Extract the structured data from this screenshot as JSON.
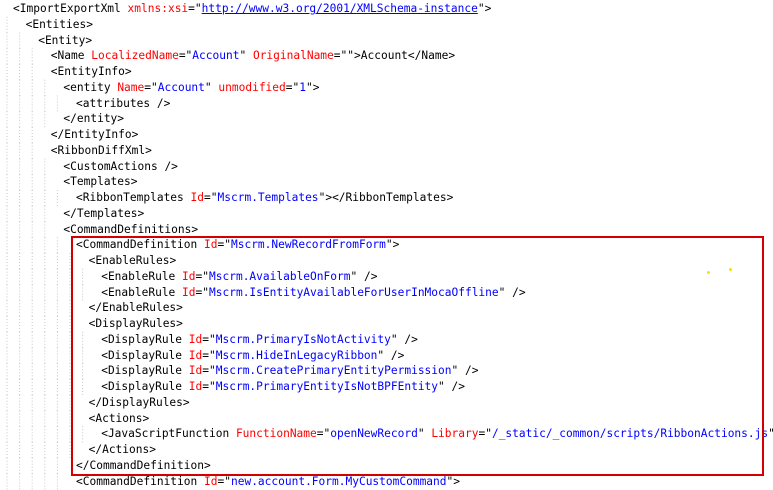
{
  "highlight_color": "#d40000",
  "lines": [
    {
      "lt": "<",
      "tag": "ImportExportXml",
      "parts": [
        {
          "a": "xmlns:xsi",
          "v": "http://www.w3.org/2001/XMLSchema-instance",
          "url": true
        }
      ],
      "end": ">"
    },
    {
      "lt": "<",
      "tag": "Entities",
      "parts": [],
      "end": ">"
    },
    {
      "lt": "<",
      "tag": "Entity",
      "parts": [],
      "end": ">"
    },
    {
      "lt": "<",
      "tag": "Name",
      "parts": [
        {
          "a": "LocalizedName",
          "v": "Account"
        },
        {
          "a": "OriginalName",
          "v": ""
        }
      ],
      "end": ">",
      "text": "Account",
      "close": "</Name>"
    },
    {
      "lt": "<",
      "tag": "EntityInfo",
      "parts": [],
      "end": ">"
    },
    {
      "lt": "<",
      "tag": "entity",
      "parts": [
        {
          "a": "Name",
          "v": "Account"
        },
        {
          "a": "unmodified",
          "v": "1"
        }
      ],
      "end": ">"
    },
    {
      "lt": "<",
      "tag": "attributes",
      "parts": [],
      "end": " />"
    },
    {
      "lt": "</",
      "tag": "entity",
      "parts": [],
      "end": ">"
    },
    {
      "lt": "</",
      "tag": "EntityInfo",
      "parts": [],
      "end": ">"
    },
    {
      "lt": "<",
      "tag": "RibbonDiffXml",
      "parts": [],
      "end": ">"
    },
    {
      "lt": "<",
      "tag": "CustomActions",
      "parts": [],
      "end": " />"
    },
    {
      "lt": "<",
      "tag": "Templates",
      "parts": [],
      "end": ">"
    },
    {
      "lt": "<",
      "tag": "RibbonTemplates",
      "parts": [
        {
          "a": "Id",
          "v": "Mscrm.Templates"
        }
      ],
      "end": ">",
      "close": "</RibbonTemplates>"
    },
    {
      "lt": "</",
      "tag": "Templates",
      "parts": [],
      "end": ">"
    },
    {
      "lt": "<",
      "tag": "CommandDefinitions",
      "parts": [],
      "end": ">"
    },
    {
      "lt": "<",
      "tag": "CommandDefinition",
      "parts": [
        {
          "a": "Id",
          "v": "Mscrm.NewRecordFromForm"
        }
      ],
      "end": ">"
    },
    {
      "lt": "<",
      "tag": "EnableRules",
      "parts": [],
      "end": ">"
    },
    {
      "lt": "<",
      "tag": "EnableRule",
      "parts": [
        {
          "a": "Id",
          "v": "Mscrm.AvailableOnForm"
        }
      ],
      "end": " />"
    },
    {
      "lt": "<",
      "tag": "EnableRule",
      "parts": [
        {
          "a": "Id",
          "v": "Mscrm.IsEntityAvailableForUserInMocaOffline"
        }
      ],
      "end": " />"
    },
    {
      "lt": "</",
      "tag": "EnableRules",
      "parts": [],
      "end": ">"
    },
    {
      "lt": "<",
      "tag": "DisplayRules",
      "parts": [],
      "end": ">"
    },
    {
      "lt": "<",
      "tag": "DisplayRule",
      "parts": [
        {
          "a": "Id",
          "v": "Mscrm.PrimaryIsNotActivity"
        }
      ],
      "end": " />"
    },
    {
      "lt": "<",
      "tag": "DisplayRule",
      "parts": [
        {
          "a": "Id",
          "v": "Mscrm.HideInLegacyRibbon"
        }
      ],
      "end": " />"
    },
    {
      "lt": "<",
      "tag": "DisplayRule",
      "parts": [
        {
          "a": "Id",
          "v": "Mscrm.CreatePrimaryEntityPermission"
        }
      ],
      "end": " />"
    },
    {
      "lt": "<",
      "tag": "DisplayRule",
      "parts": [
        {
          "a": "Id",
          "v": "Mscrm.PrimaryEntityIsNotBPFEntity"
        }
      ],
      "end": " />"
    },
    {
      "lt": "</",
      "tag": "DisplayRules",
      "parts": [],
      "end": ">"
    },
    {
      "lt": "<",
      "tag": "Actions",
      "parts": [],
      "end": ">"
    },
    {
      "lt": "<",
      "tag": "JavaScriptFunction",
      "parts": [
        {
          "a": "FunctionName",
          "v": "openNewRecord"
        },
        {
          "a": "Library",
          "v": "/_static/_common/scripts/RibbonActions.js"
        }
      ],
      "end": " />"
    },
    {
      "lt": "</",
      "tag": "Actions",
      "parts": [],
      "end": ">"
    },
    {
      "lt": "</",
      "tag": "CommandDefinition",
      "parts": [],
      "end": ">"
    },
    {
      "lt": "<",
      "tag": "CommandDefinition",
      "parts": [
        {
          "a": "Id",
          "v": "new.account.Form.MyCustomCommand"
        }
      ],
      "end": ">"
    }
  ]
}
